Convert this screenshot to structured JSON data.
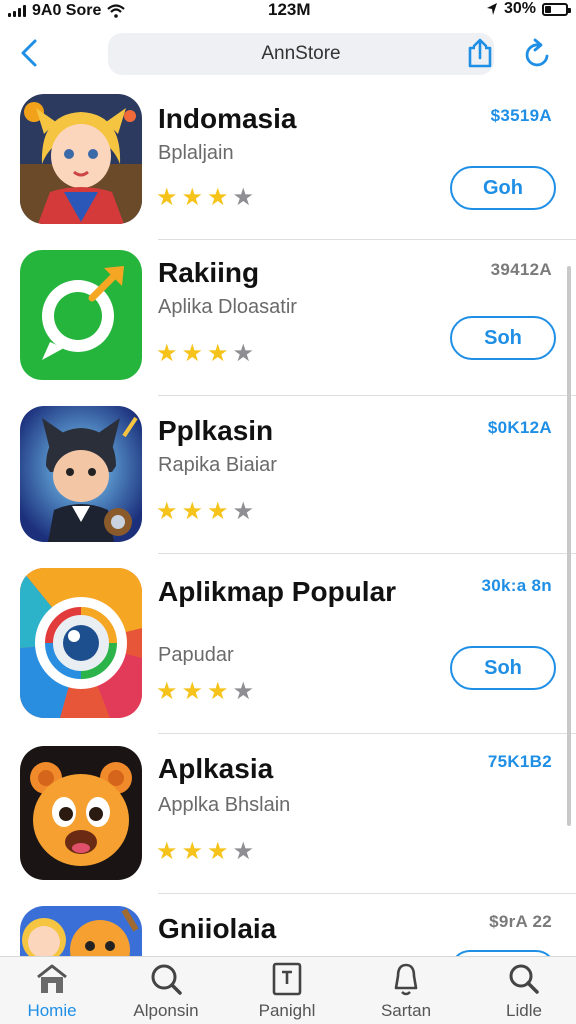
{
  "status_bar": {
    "carrier": "9A0 Sore",
    "time": "123M",
    "battery": "30%",
    "battery_level": 0.3
  },
  "nav": {
    "title": "AnnStore",
    "back_icon": "chevron-left-icon",
    "share_icon": "share-icon",
    "refresh_icon": "refresh-icon"
  },
  "apps": [
    {
      "name": "Indomasia",
      "subtitle": "Bplaljain",
      "price": "$3519A",
      "price_color": "#1f8fe6",
      "button": "Goh",
      "rating": 3,
      "max_rating": 4,
      "icon": "warrior-girl-game-icon"
    },
    {
      "name": "Rakiing",
      "subtitle": "Aplika Dloasatir",
      "price": "39412A",
      "price_color": "#7a7a7a",
      "button": "Soh",
      "rating": 3,
      "max_rating": 4,
      "icon": "chat-bubble-arrow-icon"
    },
    {
      "name": "Pplkasin",
      "subtitle": "Rapika Biaiar",
      "price": "$0K12A",
      "price_color": "#1f8fe6",
      "button": "",
      "rating": 3,
      "max_rating": 4,
      "icon": "cat-mask-hero-icon"
    },
    {
      "name": "Aplikmap Popular",
      "subtitle": "Papudar",
      "price": "30k:a 8n",
      "price_color": "#1f8fe6",
      "button": "Soh",
      "rating": 3,
      "max_rating": 4,
      "icon": "camera-lens-icon"
    },
    {
      "name": "Aplkasia",
      "subtitle": "Applka Bhslain",
      "price": "75K1B2",
      "price_color": "#1f8fe6",
      "button": "",
      "rating": 3,
      "max_rating": 4,
      "icon": "bear-face-icon"
    },
    {
      "name": "Gniiolaia",
      "subtitle": "",
      "price": "$9rA 22",
      "price_color": "#7a7a7a",
      "button": "",
      "rating": 0,
      "max_rating": 0,
      "icon": "cartoon-characters-icon"
    }
  ],
  "tabs": [
    {
      "label": "Homie",
      "icon": "home-icon",
      "active": true
    },
    {
      "label": "Alponsin",
      "icon": "search-icon",
      "active": false
    },
    {
      "label": "Panighl",
      "icon": "document-icon",
      "active": false
    },
    {
      "label": "Sartan",
      "icon": "bell-icon",
      "active": false
    },
    {
      "label": "Lidle",
      "icon": "magnifier-icon",
      "active": false
    }
  ]
}
